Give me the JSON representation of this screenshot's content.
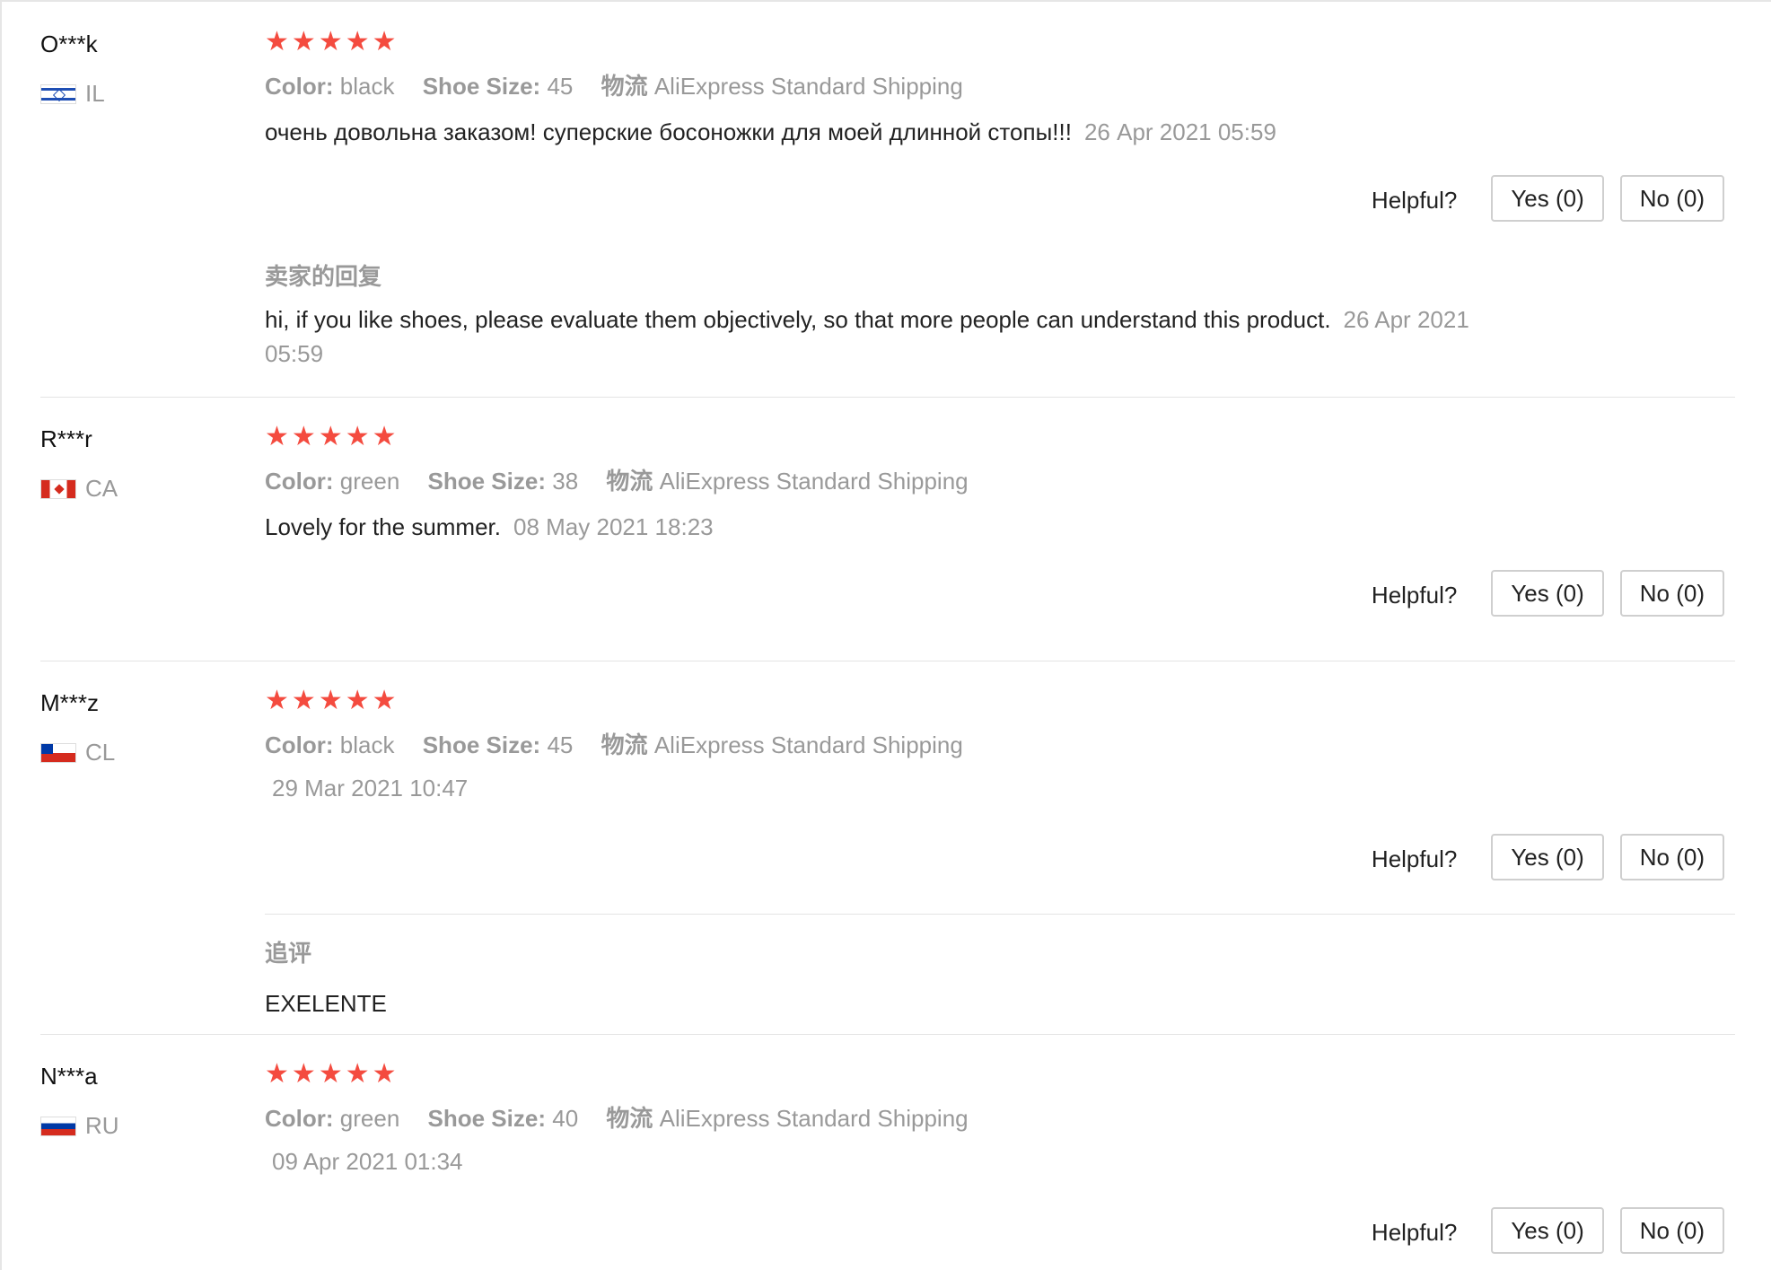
{
  "labels": {
    "color": "Color:",
    "size": "Shoe Size:",
    "logistics": "物流",
    "helpful": "Helpful?",
    "seller_reply": "卖家的回复",
    "followup": "追评"
  },
  "reviews": [
    {
      "name": "O***k",
      "country": "IL",
      "stars": 5,
      "color": "black",
      "size": "45",
      "shipping": "AliExpress Standard Shipping",
      "text": "очень довольна заказом! суперские босоножки для моей длинной стопы!!!",
      "date": "26 Apr 2021 05:59",
      "yes": "Yes (0)",
      "no": "No (0)",
      "reply": "hi, if you like shoes, please evaluate them objectively, so that more people can understand this product.",
      "reply_date": "26 Apr 2021 05:59"
    },
    {
      "name": "R***r",
      "country": "CA",
      "stars": 5,
      "color": "green",
      "size": "38",
      "shipping": "AliExpress Standard Shipping",
      "text": "Lovely for the summer.",
      "date": "08 May 2021 18:23",
      "yes": "Yes (0)",
      "no": "No (0)"
    },
    {
      "name": "M***z",
      "country": "CL",
      "stars": 5,
      "color": "black",
      "size": "45",
      "shipping": "AliExpress Standard Shipping",
      "date": "29 Mar 2021 10:47",
      "yes": "Yes (0)",
      "no": "No (0)",
      "followup": "EXELENTE"
    },
    {
      "name": "N***a",
      "country": "RU",
      "stars": 5,
      "color": "green",
      "size": "40",
      "shipping": "AliExpress Standard Shipping",
      "date": "09 Apr 2021 01:34",
      "yes": "Yes (0)",
      "no": "No (0)"
    }
  ]
}
